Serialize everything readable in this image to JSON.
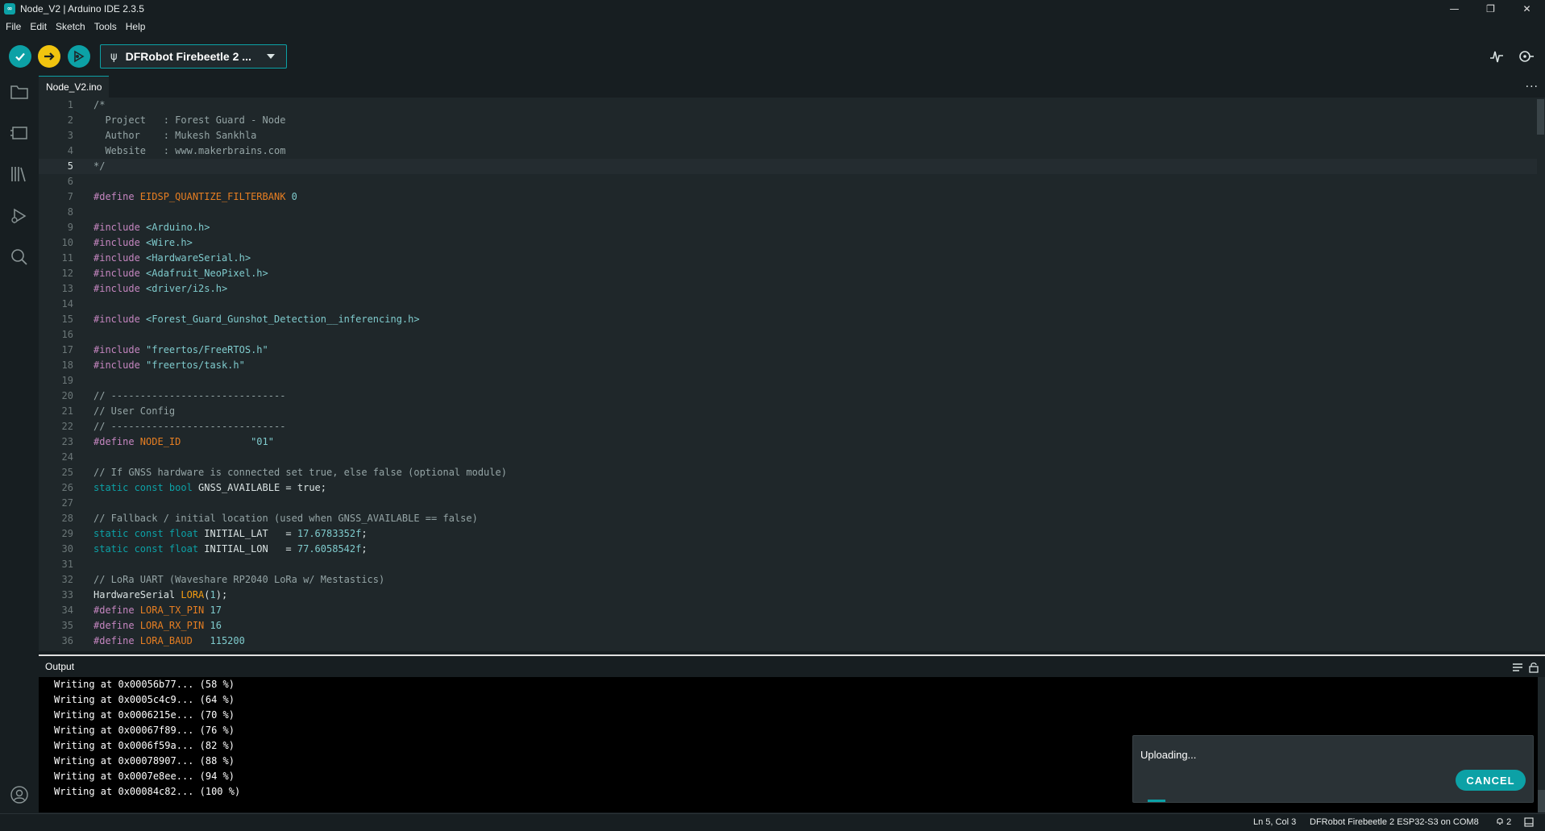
{
  "window": {
    "title": "Node_V2 | Arduino IDE 2.3.5",
    "controls": [
      "—",
      "❐",
      "✕"
    ]
  },
  "menu": [
    "File",
    "Edit",
    "Sketch",
    "Tools",
    "Help"
  ],
  "toolbar": {
    "board": "DFRobot Firebeetle 2 ..."
  },
  "tab": {
    "label": "Node_V2.ino",
    "more": "···"
  },
  "editor": {
    "current_line": 5,
    "lines": [
      [
        {
          "t": "/*",
          "c": "c-com"
        }
      ],
      [
        {
          "t": "  Project   : Forest Guard - Node",
          "c": "c-com"
        }
      ],
      [
        {
          "t": "  Author    : Mukesh Sankhla",
          "c": "c-com"
        }
      ],
      [
        {
          "t": "  Website   : www.makerbrains.com",
          "c": "c-com"
        }
      ],
      [
        {
          "t": "*/",
          "c": "c-com"
        }
      ],
      [],
      [
        {
          "t": "#define ",
          "c": "c-pp"
        },
        {
          "t": "EIDSP_QUANTIZE_FILTERBANK",
          "c": "c-mac"
        },
        {
          "t": " 0",
          "c": "c-num"
        }
      ],
      [],
      [
        {
          "t": "#include ",
          "c": "c-pp"
        },
        {
          "t": "<Arduino.h>",
          "c": "c-str"
        }
      ],
      [
        {
          "t": "#include ",
          "c": "c-pp"
        },
        {
          "t": "<Wire.h>",
          "c": "c-str"
        }
      ],
      [
        {
          "t": "#include ",
          "c": "c-pp"
        },
        {
          "t": "<HardwareSerial.h>",
          "c": "c-str"
        }
      ],
      [
        {
          "t": "#include ",
          "c": "c-pp"
        },
        {
          "t": "<Adafruit_NeoPixel.h>",
          "c": "c-str"
        }
      ],
      [
        {
          "t": "#include ",
          "c": "c-pp"
        },
        {
          "t": "<driver/i2s.h>",
          "c": "c-str"
        }
      ],
      [],
      [
        {
          "t": "#include ",
          "c": "c-pp"
        },
        {
          "t": "<Forest_Guard_Gunshot_Detection__inferencing.h>",
          "c": "c-str"
        }
      ],
      [],
      [
        {
          "t": "#include ",
          "c": "c-pp"
        },
        {
          "t": "\"freertos/FreeRTOS.h\"",
          "c": "c-str"
        }
      ],
      [
        {
          "t": "#include ",
          "c": "c-pp"
        },
        {
          "t": "\"freertos/task.h\"",
          "c": "c-str"
        }
      ],
      [],
      [
        {
          "t": "// ------------------------------",
          "c": "c-com"
        }
      ],
      [
        {
          "t": "// User Config",
          "c": "c-com"
        }
      ],
      [
        {
          "t": "// ------------------------------",
          "c": "c-com"
        }
      ],
      [
        {
          "t": "#define ",
          "c": "c-pp"
        },
        {
          "t": "NODE_ID",
          "c": "c-mac"
        },
        {
          "t": "            \"01\"",
          "c": "c-str"
        }
      ],
      [],
      [
        {
          "t": "// If GNSS hardware is connected set true, else false (optional module)",
          "c": "c-com"
        }
      ],
      [
        {
          "t": "static const bool ",
          "c": "c-kw"
        },
        {
          "t": "GNSS_AVAILABLE = ",
          "c": "c-def"
        },
        {
          "t": "true",
          "c": "c-def"
        },
        {
          "t": ";",
          "c": "c-def"
        }
      ],
      [],
      [
        {
          "t": "// Fallback / initial location (used when GNSS_AVAILABLE == false)",
          "c": "c-com"
        }
      ],
      [
        {
          "t": "static const float ",
          "c": "c-kw"
        },
        {
          "t": "INITIAL_LAT   = ",
          "c": "c-def"
        },
        {
          "t": "17.6783352f",
          "c": "c-num"
        },
        {
          "t": ";",
          "c": "c-def"
        }
      ],
      [
        {
          "t": "static const float ",
          "c": "c-kw"
        },
        {
          "t": "INITIAL_LON   = ",
          "c": "c-def"
        },
        {
          "t": "77.6058542f",
          "c": "c-num"
        },
        {
          "t": ";",
          "c": "c-def"
        }
      ],
      [],
      [
        {
          "t": "// LoRa UART (Waveshare RP2040 LoRa w/ Mestastics)",
          "c": "c-com"
        }
      ],
      [
        {
          "t": "HardwareSerial ",
          "c": "c-def"
        },
        {
          "t": "LORA",
          "c": "c-fn"
        },
        {
          "t": "(",
          "c": "c-def"
        },
        {
          "t": "1",
          "c": "c-num"
        },
        {
          "t": ");",
          "c": "c-def"
        }
      ],
      [
        {
          "t": "#define ",
          "c": "c-pp"
        },
        {
          "t": "LORA_TX_PIN",
          "c": "c-mac"
        },
        {
          "t": " 17",
          "c": "c-num"
        }
      ],
      [
        {
          "t": "#define ",
          "c": "c-pp"
        },
        {
          "t": "LORA_RX_PIN",
          "c": "c-mac"
        },
        {
          "t": " 16",
          "c": "c-num"
        }
      ],
      [
        {
          "t": "#define ",
          "c": "c-pp"
        },
        {
          "t": "LORA_BAUD",
          "c": "c-mac"
        },
        {
          "t": "   115200",
          "c": "c-num"
        }
      ]
    ]
  },
  "output": {
    "title": "Output",
    "lines": [
      "Writing at 0x00056b77... (58 %)",
      "Writing at 0x0005c4c9... (64 %)",
      "Writing at 0x0006215e... (70 %)",
      "Writing at 0x00067f89... (76 %)",
      "Writing at 0x0006f59a... (82 %)",
      "Writing at 0x00078907... (88 %)",
      "Writing at 0x0007e8ee... (94 %)",
      "Writing at 0x00084c82... (100 %)"
    ]
  },
  "notification": {
    "message": "Uploading...",
    "cancel_label": "CANCEL",
    "progress": 0.05
  },
  "status": {
    "cursor": "Ln 5, Col 3",
    "board_port": "DFRobot Firebeetle 2 ESP32-S3 on COM8",
    "notifications": "2"
  },
  "colors": {
    "accent": "#0ca1a6",
    "upload": "#f1c40f",
    "background": "#171e21",
    "editor": "#1f272a"
  }
}
